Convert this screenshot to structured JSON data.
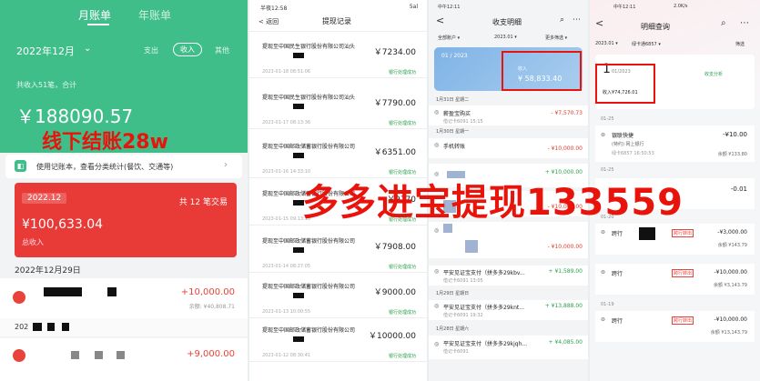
{
  "p1": {
    "tab_month": "月账单",
    "tab_year": "年账单",
    "month": "2022年12月",
    "expense": "支出",
    "income": "收入",
    "other": "其他",
    "summary": "共收入51笔，合计",
    "total": "￥188090.57",
    "bar_text": "使用记账本，查看分类统计(餐饮、交通等)",
    "card_month": "2022.12",
    "card_count": "共 12 笔交易",
    "card_amount": "¥100,633.04",
    "card_label": "总收入",
    "date1": "2022年12月29日",
    "amt1": "+10,000.00",
    "bal1": "余额: ¥40,808.71",
    "date2": "202",
    "amt2": "+9,000.00",
    "overlay": "线下结账28w"
  },
  "p2": {
    "time": "半夜12:58",
    "status": "5al",
    "back": "< 返回",
    "title": "提现记录",
    "items": [
      {
        "name": "提现至中国民生银行股份有限公司汕头",
        "amount": "￥7234.00",
        "date": "2023-01-18 08:51:06",
        "status": "银行处理成功"
      },
      {
        "name": "提现至中国民生银行股份有限公司汕头",
        "amount": "￥7790.00",
        "date": "2023-01-17 08:13:36",
        "status": "银行处理成功"
      },
      {
        "name": "提现至中国邮政储蓄银行股份有限公司",
        "amount": "￥6351.00",
        "date": "2023-01-16 14:33:10",
        "status": "银行处理成功"
      },
      {
        "name": "提现至中国邮政储蓄银行股份有限公司",
        "amount": "￥9770",
        "date": "2023-01-15 09:13:18",
        "status": "银行处理成功"
      },
      {
        "name": "提现至中国邮政储蓄银行股份有限公司",
        "amount": "￥7908.00",
        "date": "2023-01-14 08:27:05",
        "status": "银行处理成功"
      },
      {
        "name": "提现至中国邮政储蓄银行股份有限公司",
        "amount": "￥9000.00",
        "date": "2023-01-13 10:00:55",
        "status": "银行处理成功"
      },
      {
        "name": "提现至中国邮政储蓄银行股份有限公司",
        "amount": "￥10000.00",
        "date": "2023-01-12 08:30:41",
        "status": "银行处理成功"
      }
    ]
  },
  "p3": {
    "time": "中午12:11",
    "back": "<",
    "title": "收支明细",
    "filter1": "全部账户 ▾",
    "filter2": "2023.01 ▾",
    "filter3": "更多筛选 ▾",
    "card_month": "01 / 2023",
    "card_income_label": "收入",
    "card_income": "¥ 58,833.40",
    "d1": "1月31日 星期二",
    "i1_name": "薪盈宝购买",
    "i1_sub": "借记卡6091 15:15",
    "i1_amt": "- ¥7,570.73",
    "d2": "1月30日 星期一",
    "i2_name": "手机转账",
    "i2_amt": "- ¥10,000.00",
    "i3_amt": "+ ¥10,000.00",
    "i4_amt": "- ¥10,000.00",
    "i5_amt": "- ¥10,000.00",
    "i6_name": "平安见证宝支付（拼多多29kbv...",
    "i6_sub": "借记卡6091 13:05",
    "i6_amt": "+ ¥1,589.00",
    "d3": "1月29日 星期日",
    "i7_name": "平安见证宝支付（拼多多29knt...",
    "i7_sub": "借记卡6091 19:32",
    "i7_amt": "+ ¥13,888.00",
    "d4": "1月28日 星期六",
    "i8_name": "平安见证宝支付（拼多多29kjqh...",
    "i8_sub": "借记卡6091",
    "i8_amt": "+ ¥4,085.00"
  },
  "p4": {
    "time": "中午12:11",
    "status": "2.0K/s",
    "back": "<",
    "title": "明细查询",
    "filter_month": "2023.01 ▾",
    "filter_card": "绿卡通6857 ▾",
    "filter_right": "筛选",
    "big_day": "1",
    "big_month": "01/2023",
    "income_line": "收入¥74,726.01",
    "summary_btn": "收支分析",
    "s1": "01-25",
    "e1_name": "银联快捷",
    "e1_sub": "(特约) 网上银行",
    "e1_card": "绿卡6857 16:50:53",
    "e1_amt": "-¥10.00",
    "e1_bal": "余额 ¥133.80",
    "s2": "01-25",
    "e2_amt": "-0.01",
    "s3": "01-20",
    "e3_name": "跨行",
    "e3_tag": "跨行转出",
    "e3_amt": "-¥3,000.00",
    "e3_bal": "余额 ¥143.79",
    "e4_name": "跨行",
    "e4_tag": "跨行转出",
    "e4_amt": "-¥10,000.00",
    "e4_bal": "余额 ¥3,143.79",
    "s5": "01-19",
    "e5_name": "跨行",
    "e5_tag": "跨行转出",
    "e5_amt": "-¥10,000.00",
    "e5_bal": "余额 ¥13,143.79"
  },
  "overlay_main": "多多进宝提现133559"
}
